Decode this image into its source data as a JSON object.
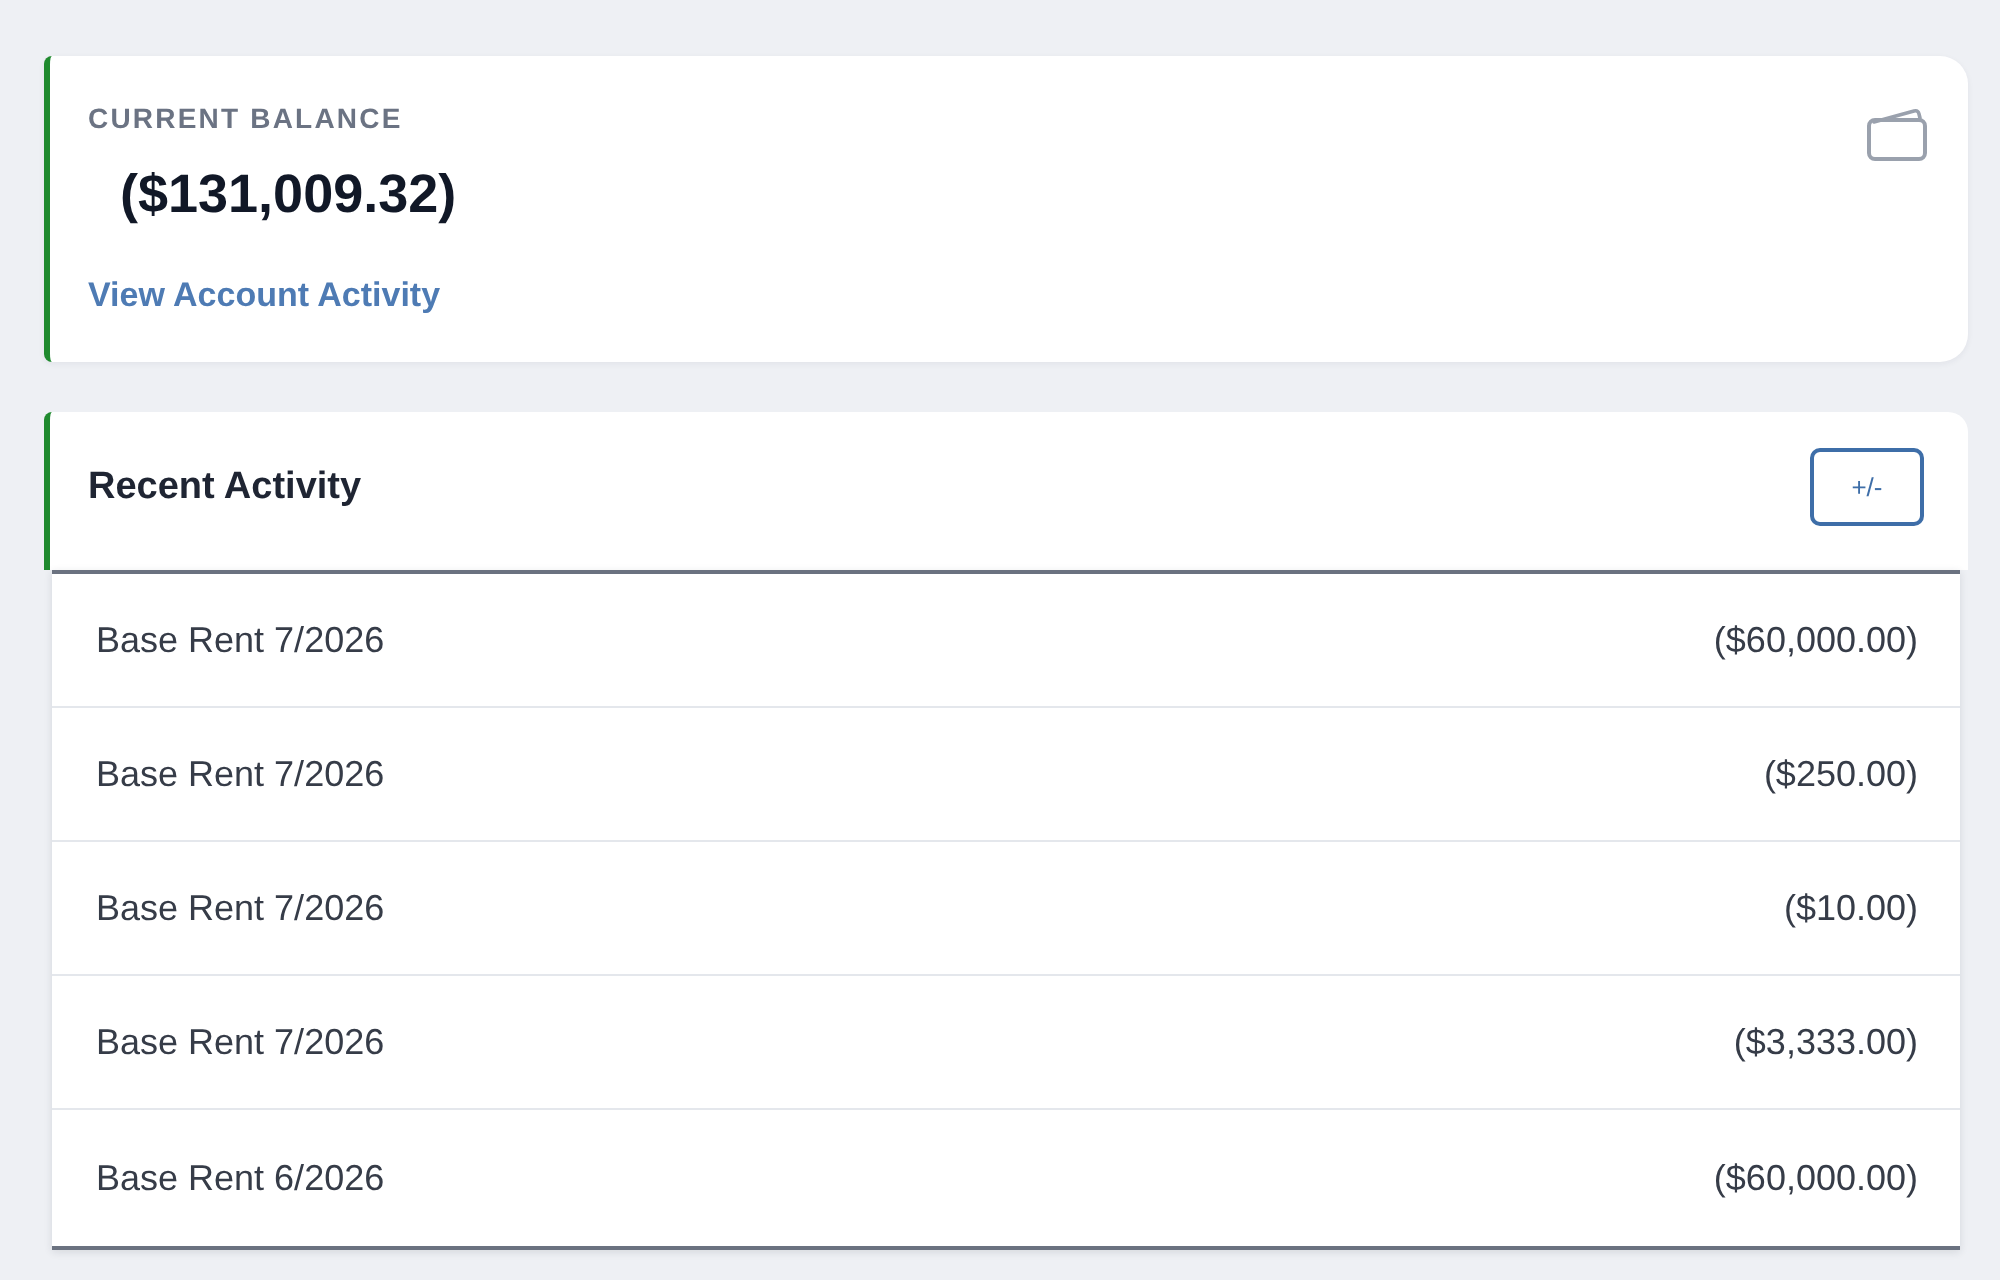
{
  "balance_card": {
    "label": "CURRENT BALANCE",
    "amount": "($131,009.32)",
    "link": "View Account Activity"
  },
  "recent_activity": {
    "title": "Recent Activity",
    "toggle_button": "+/-",
    "rows": [
      {
        "description": "Base Rent 7/2026",
        "amount": "($60,000.00)"
      },
      {
        "description": "Base Rent 7/2026",
        "amount": "($250.00)"
      },
      {
        "description": "Base Rent 7/2026",
        "amount": "($10.00)"
      },
      {
        "description": "Base Rent 7/2026",
        "amount": "($3,333.00)"
      },
      {
        "description": "Base Rent 6/2026",
        "amount": "($60,000.00)"
      }
    ]
  }
}
